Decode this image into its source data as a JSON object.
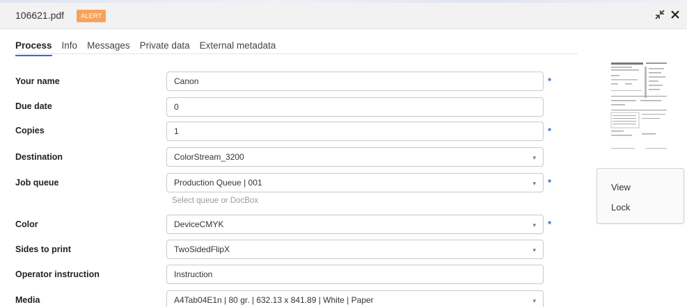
{
  "header": {
    "file_name": "106621.pdf",
    "badge": "ALERT",
    "icons": [
      "collapse-arrows-icon",
      "close-icon"
    ]
  },
  "tabs": [
    {
      "label": "Process",
      "active": true
    },
    {
      "label": "Info",
      "active": false
    },
    {
      "label": "Messages",
      "active": false
    },
    {
      "label": "Private data",
      "active": false
    },
    {
      "label": "External metadata",
      "active": false
    }
  ],
  "form": {
    "your_name": {
      "label": "Your name",
      "value": "Canon",
      "required": "*"
    },
    "due_date": {
      "label": "Due date",
      "value": "0"
    },
    "copies": {
      "label": "Copies",
      "value": "1",
      "required": "*"
    },
    "destination": {
      "label": "Destination",
      "value": "ColorStream_3200"
    },
    "job_queue": {
      "label": "Job queue",
      "value": "Production Queue | 001",
      "required": "*",
      "hint": "Select queue or DocBox"
    },
    "color": {
      "label": "Color",
      "value": "DeviceCMYK",
      "required": "*"
    },
    "sides": {
      "label": "Sides to print",
      "value": "TwoSidedFlipX"
    },
    "operator_instruction": {
      "label": "Operator instruction",
      "value": "Instruction"
    },
    "media": {
      "label": "Media",
      "value": "A4Tab04E1n | 80 gr. | 632.13 x 841.89 | White | Paper"
    }
  },
  "side_menu": {
    "view": "View",
    "lock": "Lock"
  },
  "colors": {
    "accent": "#2b6fd6",
    "badge": "#f5a35c"
  }
}
